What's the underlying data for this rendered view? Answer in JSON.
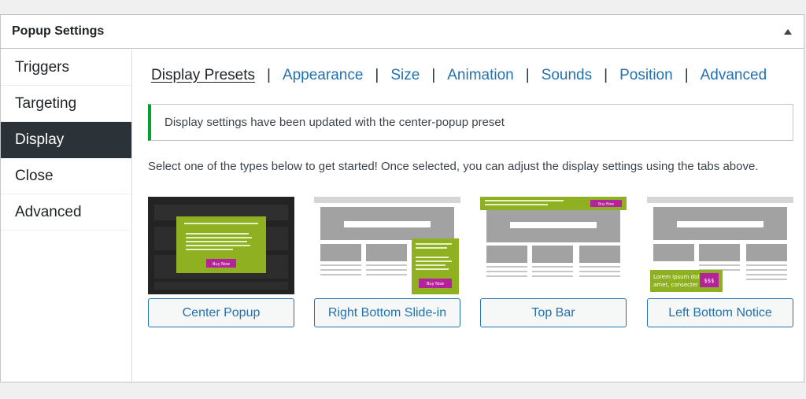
{
  "panel": {
    "title": "Popup Settings",
    "collapse_icon": "triangle-up-icon"
  },
  "sidebar": {
    "items": [
      {
        "label": "Triggers",
        "active": false
      },
      {
        "label": "Targeting",
        "active": false
      },
      {
        "label": "Display",
        "active": true
      },
      {
        "label": "Close",
        "active": false
      },
      {
        "label": "Advanced",
        "active": false
      }
    ]
  },
  "tabs": {
    "items": [
      {
        "label": "Display Presets",
        "current": true
      },
      {
        "label": "Appearance",
        "current": false
      },
      {
        "label": "Size",
        "current": false
      },
      {
        "label": "Animation",
        "current": false
      },
      {
        "label": "Sounds",
        "current": false
      },
      {
        "label": "Position",
        "current": false
      },
      {
        "label": "Advanced",
        "current": false
      }
    ],
    "separator": "|"
  },
  "notice": {
    "text": "Display settings have been updated with the center-popup preset",
    "color": "#00a32a"
  },
  "intro": "Select one of the types below to get started! Once selected, you can adjust the display settings using the tabs above.",
  "presets": [
    {
      "label": "Center Popup",
      "cta": "Buy Now"
    },
    {
      "label": "Right Bottom Slide-in",
      "cta": "Buy Now"
    },
    {
      "label": "Top Bar",
      "cta": "Buy Now"
    },
    {
      "label": "Left Bottom Notice",
      "cta": "$$$",
      "notice_text_1": "Lorem ipsum dol",
      "notice_text_2": "amet, consecter"
    }
  ],
  "colors": {
    "accent": "#2271b1",
    "popup_green": "#8fb021",
    "popup_cta": "#b4239b",
    "sidebar_active": "#2c3338"
  }
}
